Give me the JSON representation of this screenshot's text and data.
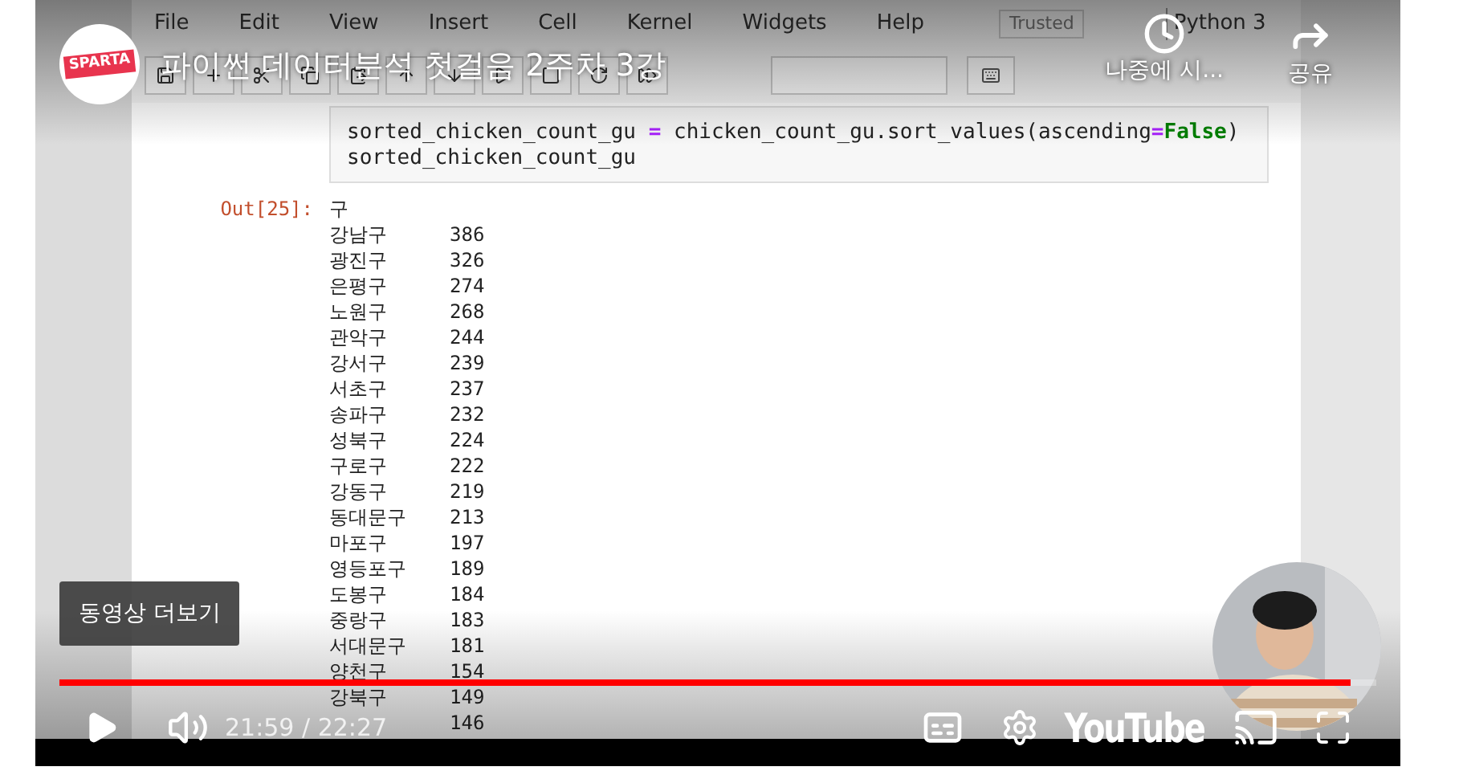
{
  "player": {
    "channel_logo": "SPARTA",
    "title": "파이썬 데이터분석 첫걸음 2주차 3강",
    "actions": [
      {
        "kind": "clock",
        "label": "나중에 시..."
      },
      {
        "kind": "share",
        "label": "공유"
      }
    ],
    "more_videos": "동영상 더보기",
    "progress": {
      "level": 0.98
    },
    "time": "21:59 / 22:27",
    "logo": "YouTube"
  },
  "notebook": {
    "menu": [
      "File",
      "Edit",
      "View",
      "Insert",
      "Cell",
      "Kernel",
      "Widgets",
      "Help"
    ],
    "trusted": "Trusted",
    "kernel": "Python 3",
    "code_lines": [
      [
        {
          "t": "sorted_chicken_count_gu ",
          "kind": "plain"
        },
        {
          "t": "=",
          "kind": "op"
        },
        {
          "t": " chicken_count_gu.sort_values(ascending",
          "kind": "plain"
        },
        {
          "t": "=",
          "kind": "op"
        },
        {
          "t": "False",
          "kind": "kw"
        },
        {
          "t": ")",
          "kind": "plain"
        }
      ],
      [
        {
          "t": "sorted_chicken_count_gu",
          "kind": "plain"
        }
      ]
    ],
    "out_prompt": "Out[25]:",
    "index_name": "구",
    "rows": [
      {
        "name": "강남구",
        "value": "386"
      },
      {
        "name": "광진구",
        "value": "326"
      },
      {
        "name": "은평구",
        "value": "274"
      },
      {
        "name": "노원구",
        "value": "268"
      },
      {
        "name": "관악구",
        "value": "244"
      },
      {
        "name": "강서구",
        "value": "239"
      },
      {
        "name": "서초구",
        "value": "237"
      },
      {
        "name": "송파구",
        "value": "232"
      },
      {
        "name": "성북구",
        "value": "224"
      },
      {
        "name": "구로구",
        "value": "222"
      },
      {
        "name": "강동구",
        "value": "219"
      },
      {
        "name": "동대문구",
        "value": "213"
      },
      {
        "name": "마포구",
        "value": "197"
      },
      {
        "name": "영등포구",
        "value": "189"
      },
      {
        "name": "도봉구",
        "value": "184"
      },
      {
        "name": "중랑구",
        "value": "183"
      },
      {
        "name": "서대문구",
        "value": "181"
      },
      {
        "name": "양천구",
        "value": "154"
      },
      {
        "name": "강북구",
        "value": "149"
      },
      {
        "value": "146"
      }
    ]
  }
}
